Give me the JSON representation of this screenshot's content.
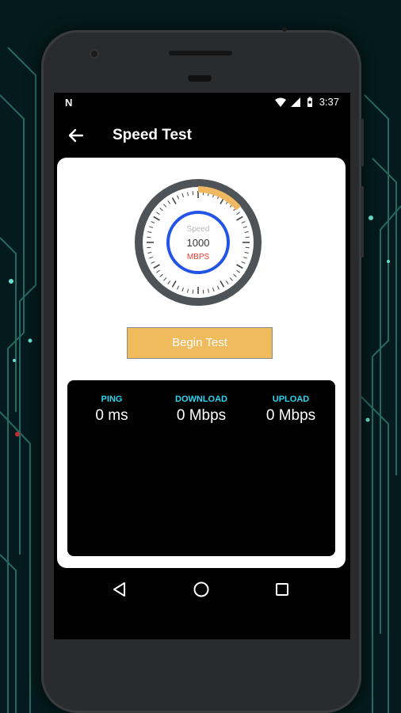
{
  "status_bar": {
    "notification_icon": "N",
    "wifi_icon": "wifi-icon",
    "signal_icon": "signal-icon",
    "battery_icon": "battery-icon",
    "time": "3:37"
  },
  "app_bar": {
    "back_icon": "arrow-left-icon",
    "title": "Speed Test"
  },
  "gauge": {
    "label": "Speed",
    "value": "1000",
    "unit": "MBPS",
    "accent_color": "#f0b860",
    "inner_ring_color": "#2354e8"
  },
  "begin_button": {
    "label": "Begin Test",
    "color": "#f0bb5c"
  },
  "stats": [
    {
      "label": "PING",
      "value": "0 ms"
    },
    {
      "label": "DOWNLOAD",
      "value": "0 Mbps"
    },
    {
      "label": "UPLOAD",
      "value": "0 Mbps"
    }
  ],
  "nav_bar": {
    "back": "triangle-back-icon",
    "home": "circle-home-icon",
    "recents": "square-recents-icon"
  }
}
